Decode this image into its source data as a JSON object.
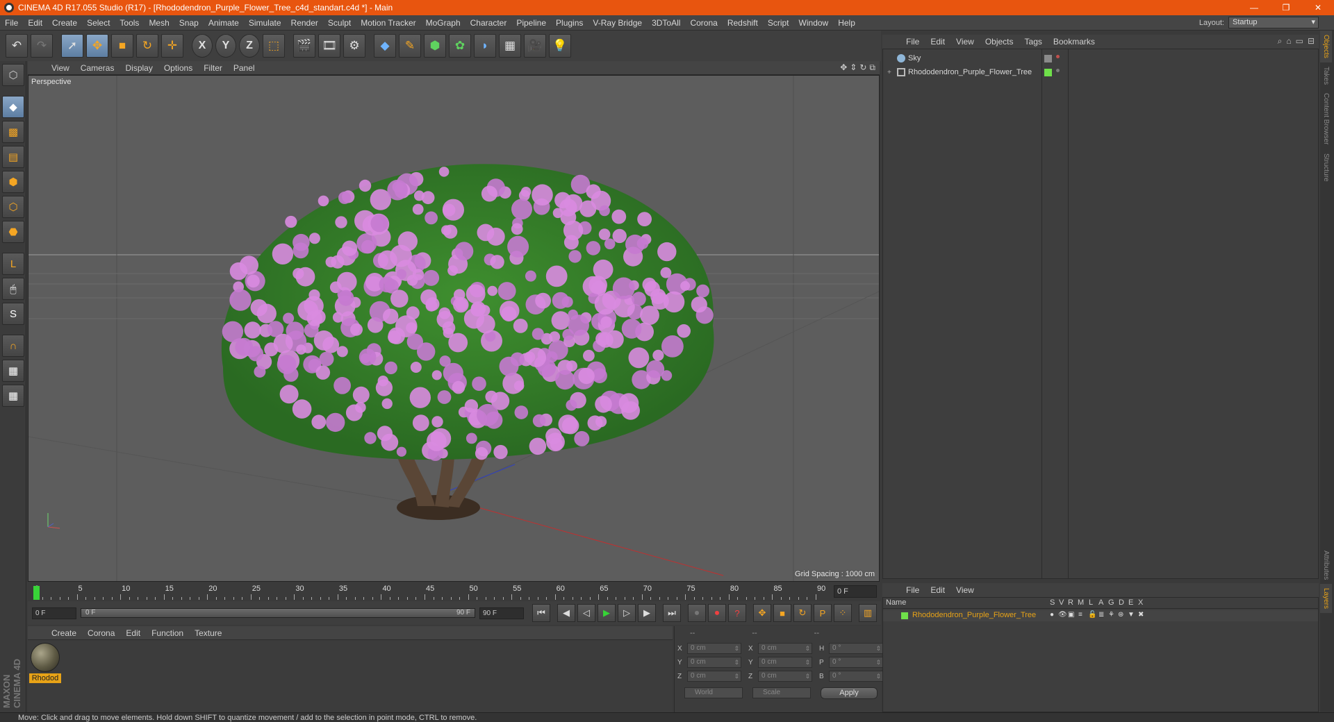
{
  "window": {
    "title": "CINEMA 4D R17.055 Studio (R17) - [Rhododendron_Purple_Flower_Tree_c4d_standart.c4d *] - Main",
    "controls": [
      "—",
      "❐",
      "✕"
    ]
  },
  "menubar": {
    "items": [
      "File",
      "Edit",
      "Create",
      "Select",
      "Tools",
      "Mesh",
      "Snap",
      "Animate",
      "Simulate",
      "Render",
      "Sculpt",
      "Motion Tracker",
      "MoGraph",
      "Character",
      "Pipeline",
      "Plugins",
      "V-Ray Bridge",
      "3DToAll",
      "Corona",
      "Redshift",
      "Script",
      "Window",
      "Help"
    ],
    "layout_label": "Layout:",
    "layout_value": "Startup"
  },
  "toolbar": {
    "buttons": [
      "undo-icon",
      "redo-icon",
      "select-icon",
      "move-icon",
      "scale-icon",
      "rotate-icon",
      "last-tool-icon",
      "x-axis-icon",
      "y-axis-icon",
      "z-axis-icon",
      "coordinate-system-icon",
      "render-view-icon",
      "render-picture-viewer-icon",
      "render-settings-icon",
      "cube-icon",
      "pen-icon",
      "subdivision-icon",
      "cloner-icon",
      "deformer-icon",
      "floor-icon",
      "camera-icon",
      "light-icon"
    ],
    "axis_x": "X",
    "axis_y": "Y",
    "axis_z": "Z"
  },
  "viewport": {
    "menu": [
      "View",
      "Cameras",
      "Display",
      "Options",
      "Filter",
      "Panel"
    ],
    "label": "Perspective",
    "grid_spacing": "Grid Spacing : 1000 cm",
    "flower_color": "#d98be0",
    "leaf_color": "#3f8f2f",
    "trunk_color": "#5a4636"
  },
  "timeline": {
    "ticks": [
      "0",
      "5",
      "10",
      "15",
      "20",
      "25",
      "30",
      "35",
      "40",
      "45",
      "50",
      "55",
      "60",
      "65",
      "70",
      "75",
      "80",
      "85",
      "90"
    ],
    "current_frame": "0 F",
    "start_field": "0 F",
    "range_start": "0 F",
    "range_end": "90 F",
    "end_field": "90 F"
  },
  "material_manager": {
    "menu": [
      "Create",
      "Corona",
      "Edit",
      "Function",
      "Texture"
    ],
    "material_name": "Rhodod"
  },
  "coordinates": {
    "headers": [
      "--",
      "--",
      "--"
    ],
    "rows": [
      {
        "a": "X",
        "pos": "0 cm",
        "b": "X",
        "size": "0 cm",
        "c": "H",
        "rot": "0 °"
      },
      {
        "a": "Y",
        "pos": "0 cm",
        "b": "Y",
        "size": "0 cm",
        "c": "P",
        "rot": "0 °"
      },
      {
        "a": "Z",
        "pos": "0 cm",
        "b": "Z",
        "size": "0 cm",
        "c": "B",
        "rot": "0 °"
      }
    ],
    "space_select": "World",
    "mode_select": "Scale",
    "apply_label": "Apply"
  },
  "object_manager": {
    "menu": [
      "File",
      "Edit",
      "View",
      "Objects",
      "Tags",
      "Bookmarks"
    ],
    "objects": [
      {
        "name": "Sky",
        "expander": ""
      },
      {
        "name": "Rhododendron_Purple_Flower_Tree",
        "expander": "+"
      }
    ]
  },
  "side_tabs": [
    "Objects",
    "Takes",
    "Content Browser",
    "Structure",
    "Attributes",
    "Layers"
  ],
  "layer_manager": {
    "menu": [
      "File",
      "Edit",
      "View"
    ],
    "columns": [
      "Name",
      "S",
      "V",
      "R",
      "M",
      "L",
      "A",
      "G",
      "D",
      "E",
      "X"
    ],
    "layer_name": "Rhododendron_Purple_Flower_Tree"
  },
  "status": "Move: Click and drag to move elements. Hold down SHIFT to quantize movement / add to the selection in point mode, CTRL to remove."
}
